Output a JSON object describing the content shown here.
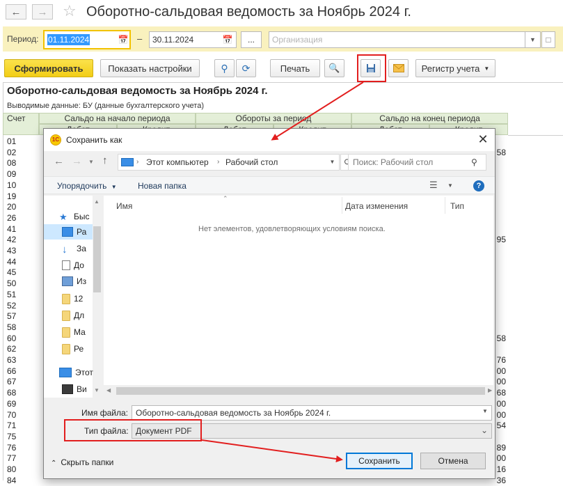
{
  "window": {
    "title": "Оборотно-сальдовая ведомость за Ноябрь 2024 г."
  },
  "period_bar": {
    "label": "Период:",
    "date_from": "01.11.2024",
    "separator": "–",
    "date_to": "30.11.2024",
    "ellipsis": "...",
    "org_placeholder": "Организация"
  },
  "toolbar": {
    "generate": "Сформировать",
    "show_settings": "Показать настройки",
    "print": "Печать",
    "register": "Регистр учета"
  },
  "report": {
    "title": "Оборотно-сальдовая ведомость за Ноябрь 2024 г.",
    "subtitle": "Выводимые данные:  БУ (данные бухгалтерского учета)",
    "col_account": "Счет",
    "col_start": "Сальдо на начало периода",
    "col_turnover": "Обороты за период",
    "col_end": "Сальдо на конец периода",
    "sub_debit": "Дебет",
    "sub_credit": "Кредит",
    "accounts": [
      "01",
      "02",
      "08",
      "09",
      "10",
      "19",
      "20",
      "26",
      "41",
      "42",
      "43",
      "44",
      "45",
      "50",
      "51",
      "52",
      "57",
      "58",
      "60",
      "62",
      "63",
      "66",
      "67",
      "68",
      "69",
      "70",
      "71",
      "75",
      "76",
      "77",
      "80",
      "84"
    ],
    "right_values": [
      {
        "row": 1,
        "text": "58"
      },
      {
        "row": 9,
        "text": "95"
      },
      {
        "row": 18,
        "text": "58"
      },
      {
        "row": 20,
        "text": "76"
      },
      {
        "row": 21,
        "text": "00"
      },
      {
        "row": 22,
        "text": "00"
      },
      {
        "row": 23,
        "text": "68"
      },
      {
        "row": 24,
        "text": "00"
      },
      {
        "row": 25,
        "text": "00"
      },
      {
        "row": 26,
        "text": "54"
      },
      {
        "row": 28,
        "text": "89"
      },
      {
        "row": 29,
        "text": "00"
      },
      {
        "row": 30,
        "text": "16"
      },
      {
        "row": 31,
        "text": "36"
      }
    ]
  },
  "dialog": {
    "title": "Сохранить как",
    "path_computer": "Этот компьютер",
    "path_desktop": "Рабочий стол",
    "search_placeholder": "Поиск: Рабочий стол",
    "organize": "Упорядочить",
    "new_folder": "Новая папка",
    "col_name": "Имя",
    "col_date": "Дата изменения",
    "col_type": "Тип",
    "empty_message": "Нет элементов, удовлетворяющих условиям поиска.",
    "sidebar": [
      {
        "label": "Быс",
        "icon": "star-icon"
      },
      {
        "label": "Ра",
        "icon": "desktop-icon"
      },
      {
        "label": "За",
        "icon": "download-icon"
      },
      {
        "label": "До",
        "icon": "document-icon"
      },
      {
        "label": "Из",
        "icon": "image-icon"
      },
      {
        "label": "12",
        "icon": "folder-icon"
      },
      {
        "label": "Дл",
        "icon": "folder-icon"
      },
      {
        "label": "Ма",
        "icon": "folder-icon"
      },
      {
        "label": "Ре",
        "icon": "folder-icon"
      },
      {
        "label": "Этот",
        "icon": "computer-icon"
      },
      {
        "label": "Ви",
        "icon": "video-icon"
      }
    ],
    "filename_label": "Имя файла:",
    "filename_value": "Оборотно-сальдовая ведомость за Ноябрь 2024 г.",
    "filetype_label": "Тип файла:",
    "filetype_value": "Документ PDF",
    "hide_folders": "Скрыть папки",
    "save": "Сохранить",
    "cancel": "Отмена",
    "app_logo_text": "1С"
  },
  "colors": {
    "period_bar_bg": "#f9f1be",
    "generate_button": "#f2cd16",
    "highlight_red": "#e21e1e",
    "header_green": "#e4efd8",
    "selection_blue": "#3399ff"
  }
}
